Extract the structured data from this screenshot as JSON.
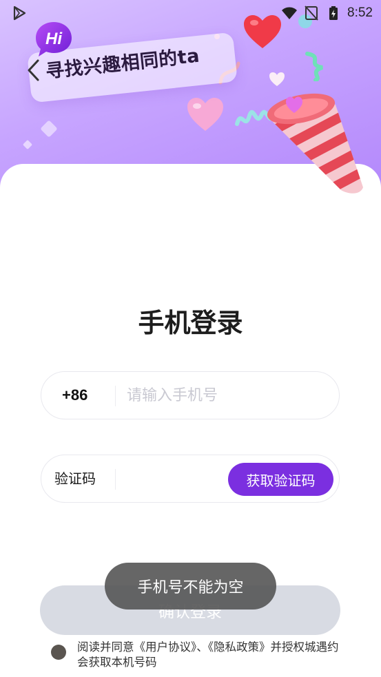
{
  "status_bar": {
    "time": "8:52",
    "icons": [
      "app-play-icon",
      "wifi-icon",
      "no-signal-icon",
      "battery-charging-icon"
    ]
  },
  "banner": {
    "hi_badge": "Hi",
    "slogan": "寻找兴趣相同的ta",
    "colors": {
      "gradient_start": "#d9c3ff",
      "gradient_end": "#b286fb"
    }
  },
  "login": {
    "title": "手机登录",
    "phone": {
      "prefix": "+86",
      "placeholder": "请输入手机号",
      "value": ""
    },
    "code": {
      "label": "验证码",
      "value": "",
      "get_code_label": "获取验证码"
    },
    "submit_label": "确认登录",
    "agreement_text": "阅读并同意《用户协议》、《隐私政策》并授权城遇约会获取本机号码"
  },
  "toast": {
    "message": "手机号不能为空"
  },
  "colors": {
    "accent": "#7b2fe0",
    "button_disabled": "#d8dbe3",
    "toast_bg": "#555555"
  }
}
